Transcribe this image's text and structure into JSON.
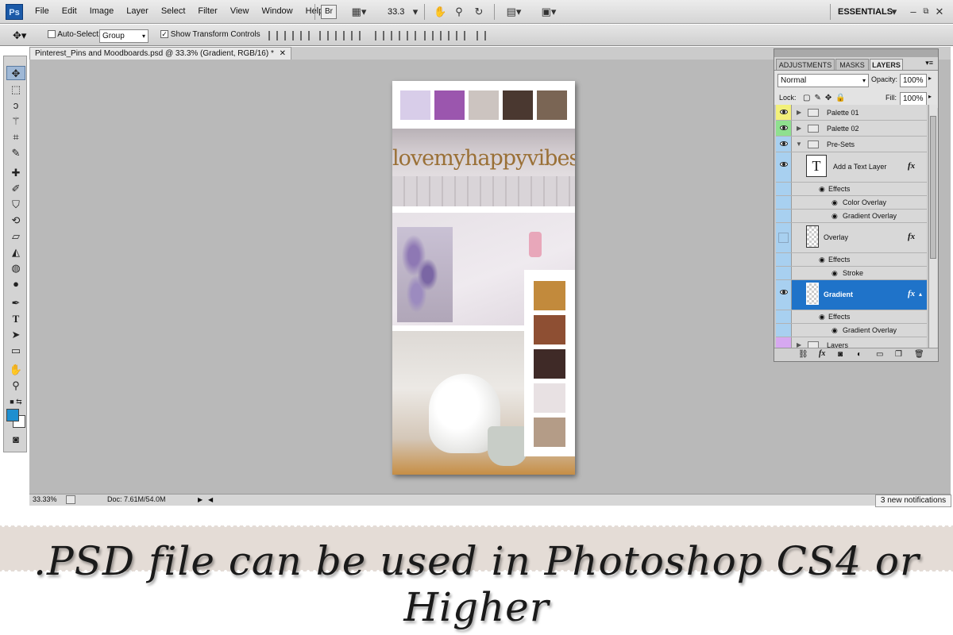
{
  "app": {
    "logo": "Ps",
    "workspace": "ESSENTIALS"
  },
  "menu": [
    "File",
    "Edit",
    "Image",
    "Layer",
    "Select",
    "Filter",
    "View",
    "Window",
    "Help"
  ],
  "menubar": {
    "bridge_label": "Br",
    "zoom": "33.3"
  },
  "options": {
    "auto_select_label": "Auto-Select:",
    "auto_select_value": "Group",
    "transform_label": "Show Transform Controls"
  },
  "document": {
    "tab_title": "Pinterest_Pins and Moodboards.psd @ 33.3% (Gradient, RGB/16) *",
    "canvas_text": "lovemyhappyvibes",
    "top_swatches": [
      "#d8cde9",
      "#9b56ae",
      "#ccc4c0",
      "#4a3830",
      "#7a6554"
    ],
    "side_swatches": [
      "#c28a3c",
      "#8e4f33",
      "#3f2a27",
      "#e8e1e3",
      "#b49c87"
    ]
  },
  "status": {
    "zoom": "33.33%",
    "doc": "Doc: 7.61M/54.0M",
    "notifications": "3 new notifications"
  },
  "panel": {
    "tabs": [
      "ADJUSTMENTS",
      "MASKS",
      "LAYERS"
    ],
    "blend_mode": "Normal",
    "opacity_label": "Opacity:",
    "opacity": "100%",
    "lock_label": "Lock:",
    "fill_label": "Fill:",
    "fill": "100%",
    "layers": {
      "palette01": "Palette 01",
      "palette02": "Palette 02",
      "presets": "Pre-Sets",
      "text_layer": "Add a Text Layer",
      "effects": "Effects",
      "color_overlay": "Color Overlay",
      "gradient_overlay": "Gradient Overlay",
      "overlay": "Overlay",
      "stroke": "Stroke",
      "gradient": "Gradient",
      "layers_group": "Layers",
      "fx": "fx",
      "t_glyph": "T"
    }
  },
  "footer": {
    "caption": ".PSD file can be used in Photoshop CS4 or Higher"
  }
}
